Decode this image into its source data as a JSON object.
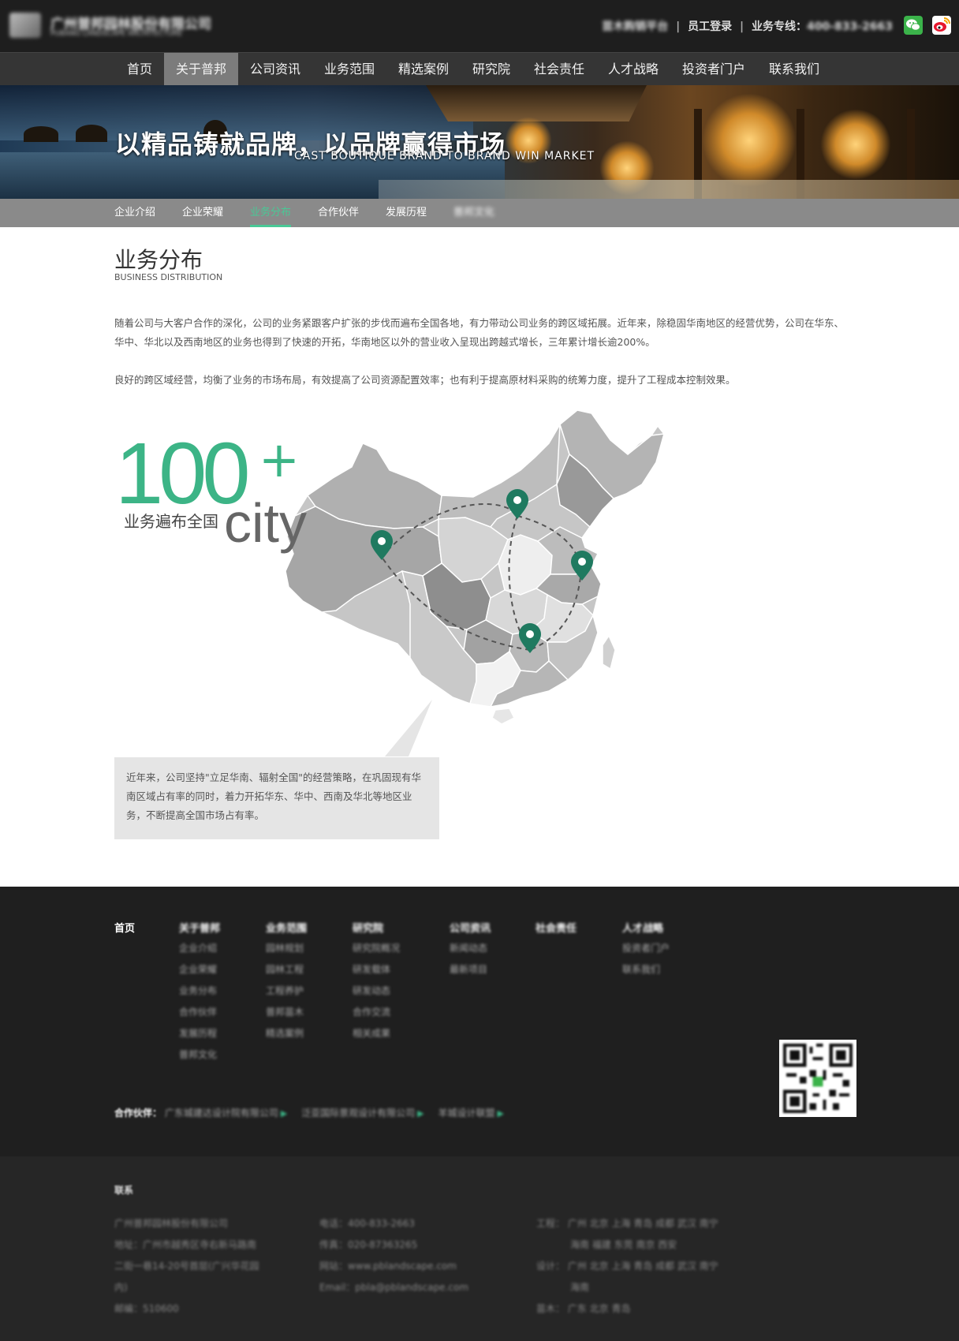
{
  "header": {
    "logo_cn": "广州普邦园林股份有限公司",
    "logo_en": "PUBANG LANDSCAPE ARCHITECTURE",
    "links": [
      "苗木购销平台",
      "员工登录"
    ],
    "hotline_label": "业务专线：",
    "hotline": "400-833-2663",
    "separator": "|"
  },
  "nav": {
    "items": [
      {
        "label": "首页"
      },
      {
        "label": "关于普邦"
      },
      {
        "label": "公司资讯"
      },
      {
        "label": "业务范围"
      },
      {
        "label": "精选案例"
      },
      {
        "label": "研究院"
      },
      {
        "label": "社会责任"
      },
      {
        "label": "人才战略"
      },
      {
        "label": "投资者门户"
      },
      {
        "label": "联系我们"
      }
    ],
    "active_index": 1
  },
  "banner": {
    "slogan_cn": "以精品铸就品牌，以品牌赢得市场",
    "slogan_en": "CAST BOUTIQUE BRAND TO BRAND WIN MARKET"
  },
  "subnav": {
    "items": [
      "企业介绍",
      "企业荣耀",
      "业务分布",
      "合作伙伴",
      "发展历程",
      "普邦文化"
    ],
    "active_index": 2,
    "accent": "#49c896"
  },
  "content": {
    "title": "业务分布",
    "subtitle": "BUSINESS DISTRIBUTION",
    "paragraph1": "随着公司与大客户合作的深化，公司的业务紧跟客户扩张的步伐而遍布全国各地，有力带动公司业务的跨区域拓展。近年来，除稳固华南地区的经营优势，公司在华东、华中、华北以及西南地区的业务也得到了快速的开拓，华南地区以外的营业收入呈现出跨越式增长，三年累计增长逾200%。",
    "paragraph2": "良好的跨区域经营，均衡了业务的市场布局，有效提高了公司资源配置效率；也有利于提高原材料采购的统筹力度，提升了工程成本控制效果。",
    "stat_number": "100",
    "stat_plus": "+",
    "stat_caption": "业务遍布全国",
    "stat_unit": "city",
    "callout": "近年来，公司坚持\"立足华南、辐射全国\"的经营策略，在巩固现有华南区域占有率的同时，着力开拓华东、华中、西南及华北等地区业务，不断提高全国市场占有率。",
    "accent": "#3cb486"
  },
  "footer": {
    "columns": [
      {
        "title": "首页",
        "items": []
      },
      {
        "title": "关于普邦",
        "items": [
          "企业介绍",
          "企业荣耀",
          "业务分布",
          "合作伙伴",
          "发展历程",
          "普邦文化"
        ]
      },
      {
        "title": "业务范围",
        "items": [
          "园林规划",
          "园林工程",
          "工程养护",
          "普邦苗木",
          "精选案例"
        ]
      },
      {
        "title": "研究院",
        "items": [
          "研究院概况",
          "研发载体",
          "研发动态",
          "合作交流",
          "相关成果"
        ]
      },
      {
        "title": "公司资讯",
        "items": [
          "新闻动态",
          "最新项目"
        ]
      },
      {
        "title": "社会责任",
        "items": []
      },
      {
        "title": "人才战略",
        "items": [
          "投资者门户",
          "联系我们"
        ]
      }
    ],
    "partners_label": "合作伙伴：",
    "partners": [
      "广东城建达设计院有限公司",
      "泛亚国际景观设计有限公司",
      "羊城设计联盟"
    ],
    "contact_title": "联系",
    "contact_col1": [
      "广州普邦园林股份有限公司",
      "地址：广州市越秀区寺右新马路南",
      "二街一巷14-20号首层(广兴华花园",
      "内)",
      "邮编：510600"
    ],
    "contact_col2": [
      "电话：400-833-2663",
      "传真：020-87363265",
      "网站：www.pblandscape.com",
      "Email：pbla@pblandscape.com"
    ],
    "contact_col3": [
      "工程： 广州 北京 上海 青岛 成都 武汉 南宁",
      "海南 福建 东莞 南京 西安",
      "设计： 广州 北京 上海 青岛 成都 武汉 南宁",
      "海南",
      "苗木： 广东 北京 青岛"
    ]
  }
}
